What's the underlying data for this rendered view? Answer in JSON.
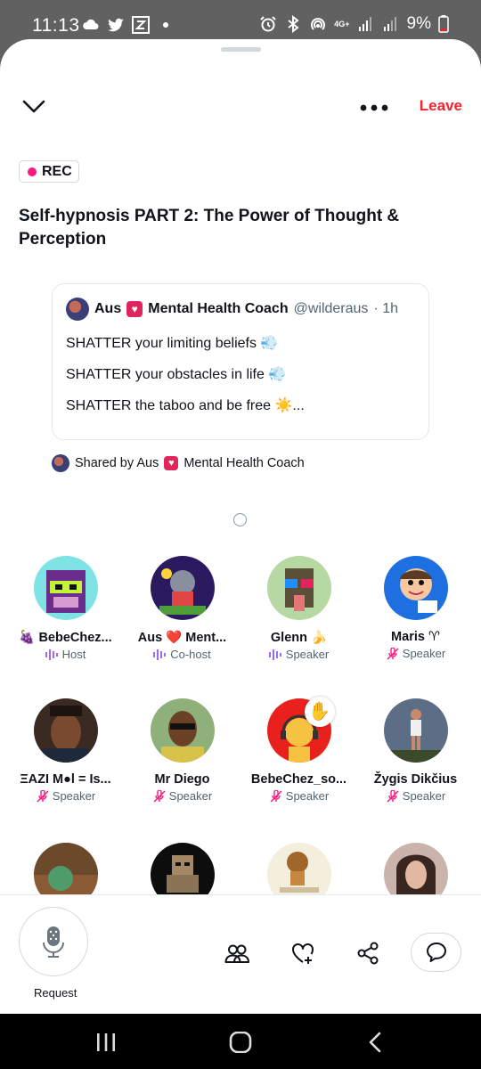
{
  "status_bar": {
    "time": "11:13",
    "battery": "9%",
    "network": "4G+",
    "left_icons": [
      "cloud-icon",
      "twitter-icon",
      "zillow-icon",
      "dot-icon"
    ],
    "right_icons": [
      "alarm-icon",
      "bluetooth-icon",
      "hotspot-icon",
      "network-icon",
      "signal-icon",
      "signal-icon",
      "battery-icon"
    ]
  },
  "header": {
    "leave_label": "Leave"
  },
  "space": {
    "rec_label": "REC",
    "title": "Self-hypnosis PART 2: The Power of Thought & Perception"
  },
  "tweet": {
    "author_name_a": "Aus",
    "author_name_b": "Mental Health Coach",
    "handle": "@wilderaus",
    "time": "· 1h",
    "lines": [
      "SHATTER your limiting beliefs 💨",
      "SHATTER your obstacles in life 💨",
      "SHATTER the taboo and be free ☀️..."
    ]
  },
  "shared_by": {
    "prefix": "Shared by Aus",
    "suffix": "Mental Health Coach"
  },
  "participants": [
    {
      "name": "🍇 BebeChez...",
      "role": "Host",
      "role_icon": "speaking-wave-icon",
      "color": "#9b6cf0"
    },
    {
      "name": "Aus ❤️ Ment...",
      "role": "Co-host",
      "role_icon": "speaking-wave-icon",
      "color": "#9b6cf0"
    },
    {
      "name": "Glenn 🍌",
      "role": "Speaker",
      "role_icon": "speaking-wave-icon",
      "color": "#9b6cf0"
    },
    {
      "name": "Maris ♈",
      "role": "Speaker",
      "role_icon": "mic-muted-icon",
      "color": "#f91880"
    },
    {
      "name": "ΞAZI M●l = Is...",
      "role": "Speaker",
      "role_icon": "mic-muted-icon",
      "color": "#f91880"
    },
    {
      "name": "Mr Diego",
      "role": "Speaker",
      "role_icon": "mic-muted-icon",
      "color": "#f91880"
    },
    {
      "name": "BebeChez_so...",
      "role": "Speaker",
      "role_icon": "mic-muted-icon",
      "color": "#f91880"
    },
    {
      "name": "Žygis Dikčius",
      "role": "Speaker",
      "role_icon": "mic-muted-icon",
      "color": "#f91880"
    },
    {
      "name": "",
      "role": "",
      "role_icon": "",
      "color": ""
    },
    {
      "name": "",
      "role": "",
      "role_icon": "",
      "color": ""
    },
    {
      "name": "",
      "role": "",
      "role_icon": "",
      "color": ""
    },
    {
      "name": "",
      "role": "",
      "role_icon": "",
      "color": ""
    }
  ],
  "bottom_bar": {
    "request_label": "Request",
    "icons": [
      "microphone-icon",
      "people-icon",
      "heart-plus-icon",
      "share-icon",
      "reply-bubble-icon"
    ]
  },
  "colors": {
    "leave": "#f4212e",
    "rec_dot": "#f91880",
    "speaking": "#9b6cf0",
    "muted": "#f91880"
  }
}
